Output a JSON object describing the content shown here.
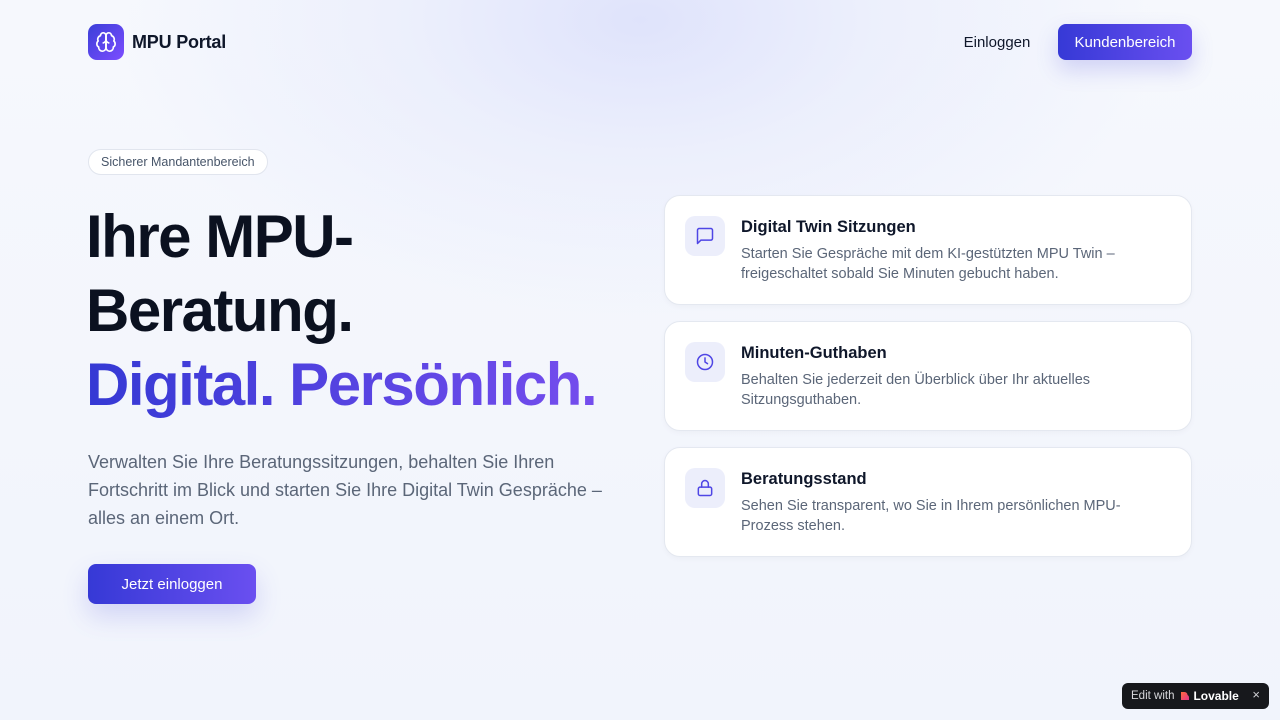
{
  "header": {
    "logo_text": "MPU Portal",
    "login_label": "Einloggen",
    "cta_label": "Kundenbereich"
  },
  "hero": {
    "badge": "Sicherer Mandantenbereich",
    "headline_line1": "Ihre MPU-",
    "headline_line2": "Beratung.",
    "headline_line3": "Digital. Persönlich.",
    "lead": "Verwalten Sie Ihre Beratungssitzungen, behalten Sie Ihren Fortschritt im Blick und starten Sie Ihre Digital Twin Gespräche – alles an einem Ort.",
    "cta_label": "Jetzt einloggen"
  },
  "features": [
    {
      "icon": "message-square-icon",
      "title": "Digital Twin Sitzungen",
      "desc": "Starten Sie Gespräche mit dem KI-gestützten MPU Twin – freigeschaltet sobald Sie Minuten gebucht haben."
    },
    {
      "icon": "clock-icon",
      "title": "Minuten-Guthaben",
      "desc": "Behalten Sie jederzeit den Überblick über Ihr aktuelles Sitzungsguthaben."
    },
    {
      "icon": "lock-icon",
      "title": "Beratungsstand",
      "desc": "Sehen Sie transparent, wo Sie in Ihrem persönlichen MPU-Prozess stehen."
    }
  ],
  "lovable_badge": {
    "prefix": "Edit with",
    "brand": "Lovable",
    "close": "×"
  },
  "colors": {
    "accent_start": "#3639d6",
    "accent_end": "#6a4ff0",
    "icon_tint": "#4f46e5"
  }
}
